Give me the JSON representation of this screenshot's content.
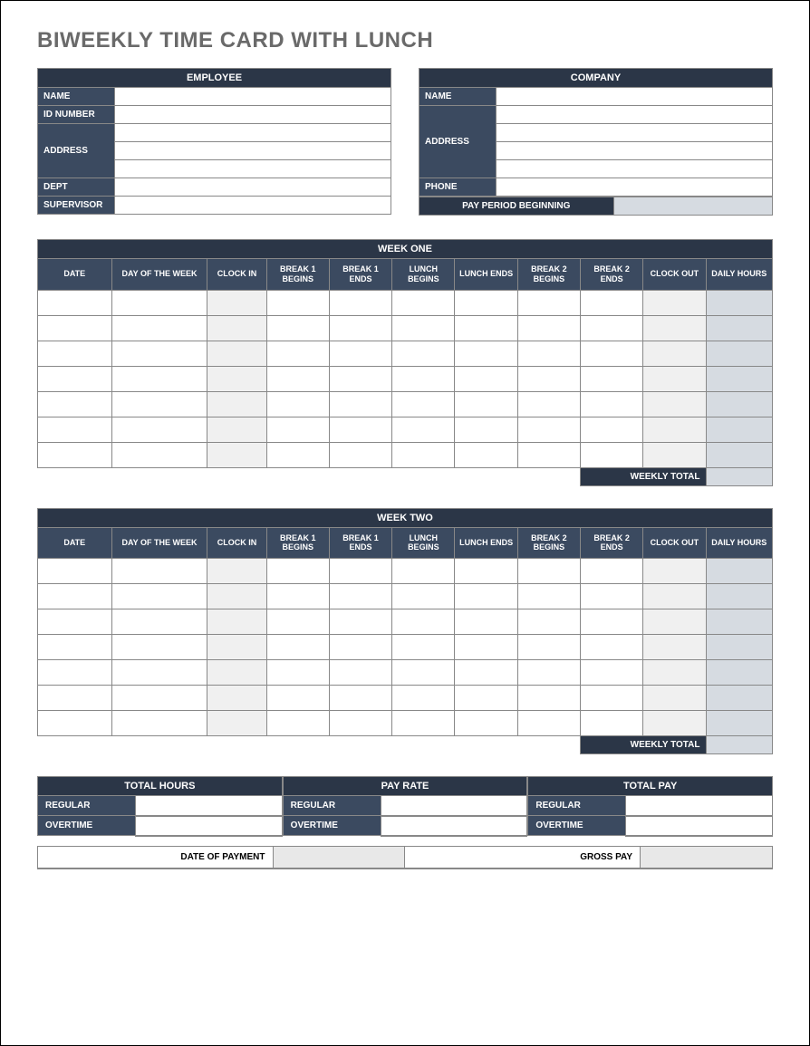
{
  "title": "BIWEEKLY TIME CARD WITH LUNCH",
  "employee": {
    "header": "EMPLOYEE",
    "name_label": "NAME",
    "id_label": "ID NUMBER",
    "address_label": "ADDRESS",
    "dept_label": "DEPT",
    "supervisor_label": "SUPERVISOR",
    "name": "",
    "id": "",
    "address1": "",
    "address2": "",
    "address3": "",
    "dept": "",
    "supervisor": ""
  },
  "company": {
    "header": "COMPANY",
    "name_label": "NAME",
    "address_label": "ADDRESS",
    "phone_label": "PHONE",
    "pay_period_label": "PAY PERIOD BEGINNING",
    "name": "",
    "address1": "",
    "address2": "",
    "address3": "",
    "address4": "",
    "phone": "",
    "pay_period": ""
  },
  "week_columns": {
    "date": "DATE",
    "dow": "DAY OF THE WEEK",
    "clock_in": "CLOCK IN",
    "b1b": "BREAK 1 BEGINS",
    "b1e": "BREAK 1 ENDS",
    "lb": "LUNCH BEGINS",
    "le": "LUNCH ENDS",
    "b2b": "BREAK 2 BEGINS",
    "b2e": "BREAK 2 ENDS",
    "clock_out": "CLOCK OUT",
    "daily": "DAILY HOURS"
  },
  "week_one": {
    "header": "WEEK ONE",
    "weekly_total_label": "WEEKLY TOTAL",
    "weekly_total": ""
  },
  "week_two": {
    "header": "WEEK TWO",
    "weekly_total_label": "WEEKLY TOTAL",
    "weekly_total": ""
  },
  "summary": {
    "total_hours_header": "TOTAL HOURS",
    "pay_rate_header": "PAY RATE",
    "total_pay_header": "TOTAL PAY",
    "regular_label": "REGULAR",
    "overtime_label": "OVERTIME",
    "hours_regular": "",
    "hours_overtime": "",
    "rate_regular": "",
    "rate_overtime": "",
    "pay_regular": "",
    "pay_overtime": ""
  },
  "footer": {
    "date_of_payment_label": "DATE OF PAYMENT",
    "gross_pay_label": "GROSS PAY",
    "date_of_payment": "",
    "gross_pay": ""
  }
}
